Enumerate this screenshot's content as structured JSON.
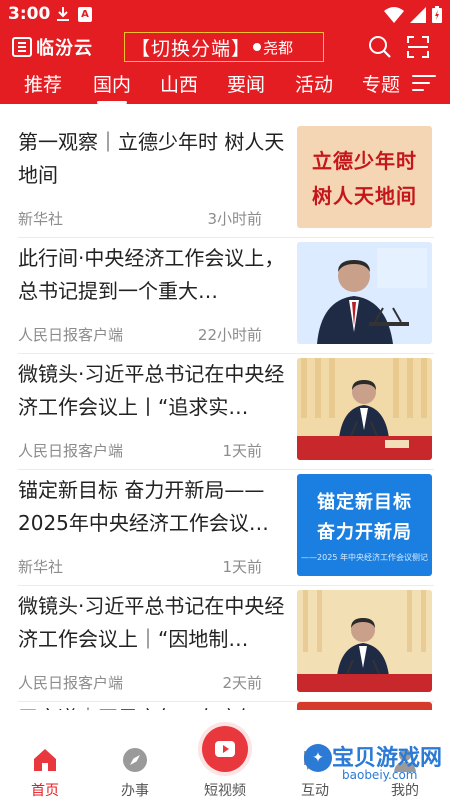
{
  "status_bar": {
    "time": "3:00"
  },
  "app_bar": {
    "logo_text": "临汾云",
    "switch_label": "【切换分端】",
    "city": "尧都"
  },
  "tabs": [
    {
      "label": "推荐",
      "active": false
    },
    {
      "label": "国内",
      "active": true
    },
    {
      "label": "山西",
      "active": false
    },
    {
      "label": "要闻",
      "active": false
    },
    {
      "label": "活动",
      "active": false
    },
    {
      "label": "专题",
      "active": false
    }
  ],
  "news": [
    {
      "title": "第一观察｜立德少年时 树人天地间",
      "source": "新华社",
      "time": "3小时前",
      "thumb_lines": [
        "立德少年时",
        "树人天地间"
      ]
    },
    {
      "title": "此行间·中央经济工作会议上，总书记提到一个重大…",
      "source": "人民日报客户端",
      "time": "22小时前"
    },
    {
      "title": "微镜头·习近平总书记在中央经济工作会议上丨“追求实…",
      "source": "人民日报客户端",
      "time": "1天前"
    },
    {
      "title": "锚定新目标 奋力开新局——2025年中央经济工作会议…",
      "source": "新华社",
      "time": "1天前",
      "thumb_lines": [
        "锚定新目标",
        "奋力开新局"
      ],
      "thumb_caption": "——2025 年中央经济工作会议侧记"
    },
    {
      "title": "微镜头·习近平总书记在中央经济工作会议上｜“因地制…",
      "source": "人民日报客户端",
      "time": "2天前"
    },
    {
      "title": "习言道｜开局之年，有底气"
    }
  ],
  "bottom_nav": [
    {
      "label": "首页",
      "icon": "home-icon",
      "active": true
    },
    {
      "label": "办事",
      "icon": "compass-icon",
      "active": false
    },
    {
      "label": "短视频",
      "icon": "play-icon",
      "active": false
    },
    {
      "label": "互动",
      "icon": "interaction-icon",
      "active": false
    },
    {
      "label": "我的",
      "icon": "user-icon",
      "active": false
    }
  ],
  "watermark": {
    "text": "宝贝游戏网",
    "url": "baobeiy.com"
  },
  "colors": {
    "brand_red": "#e41d22",
    "switch_border": "#f1c02a",
    "text_primary": "#222222",
    "text_secondary": "#8c8c8c"
  }
}
